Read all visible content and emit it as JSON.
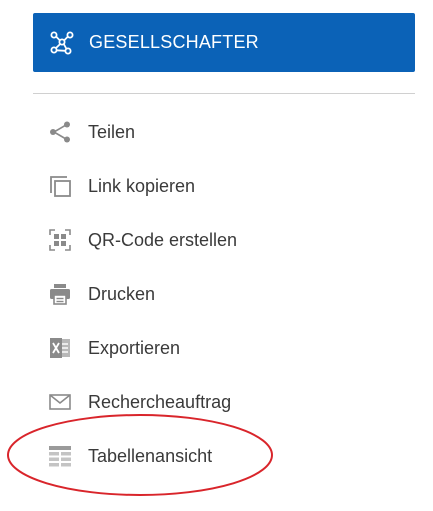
{
  "primary_button": {
    "label": "GESELLSCHAFTER",
    "icon": "network-icon",
    "background": "#0b62b7",
    "text_color": "#ffffff"
  },
  "menu": {
    "items": [
      {
        "label": "Teilen",
        "icon": "share-icon"
      },
      {
        "label": "Link kopieren",
        "icon": "copy-icon"
      },
      {
        "label": "QR-Code erstellen",
        "icon": "qr-code-icon"
      },
      {
        "label": "Drucken",
        "icon": "printer-icon"
      },
      {
        "label": "Exportieren",
        "icon": "excel-icon"
      },
      {
        "label": "Rechercheauftrag",
        "icon": "envelope-icon"
      },
      {
        "label": "Tabellenansicht",
        "icon": "table-icon"
      }
    ]
  },
  "colors": {
    "icon_gray": "#8a8a8a",
    "text": "#3a3a3a",
    "annotation": "#d9252b"
  }
}
